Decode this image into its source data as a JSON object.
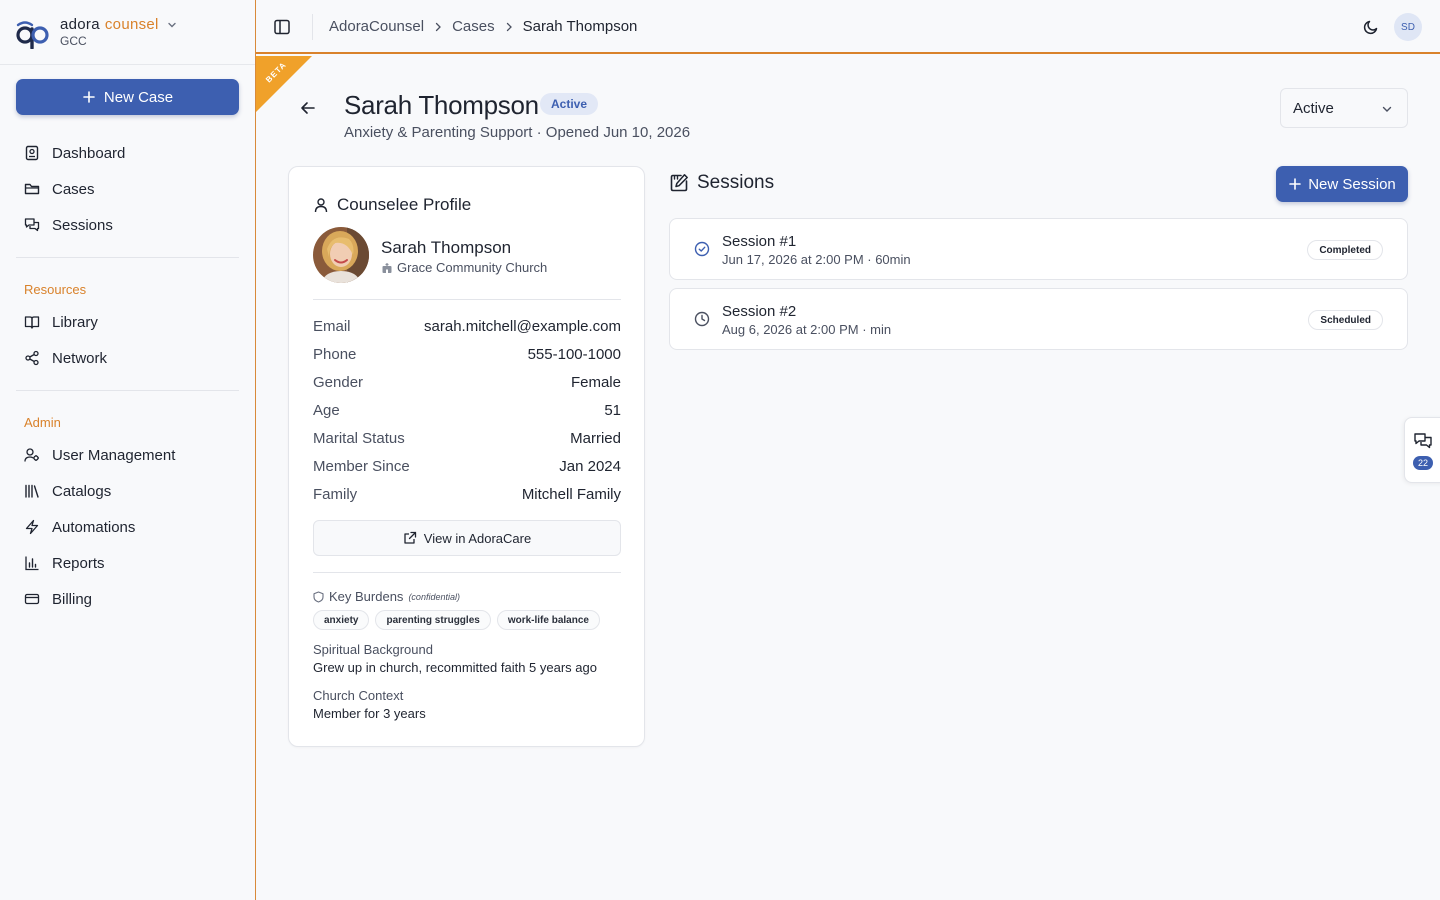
{
  "brand": {
    "name_a": "adora",
    "name_b": "counsel",
    "org": "GCC"
  },
  "sidebar": {
    "new_case_label": "New Case",
    "main_items": [
      {
        "label": "Dashboard",
        "icon": "dashboard-icon"
      },
      {
        "label": "Cases",
        "icon": "folder-icon"
      },
      {
        "label": "Sessions",
        "icon": "chat-icon"
      }
    ],
    "resources_heading": "Resources",
    "resources_items": [
      {
        "label": "Library",
        "icon": "book-icon"
      },
      {
        "label": "Network",
        "icon": "share-icon"
      }
    ],
    "admin_heading": "Admin",
    "admin_items": [
      {
        "label": "User Management",
        "icon": "users-icon"
      },
      {
        "label": "Catalogs",
        "icon": "library-icon"
      },
      {
        "label": "Automations",
        "icon": "bolt-icon"
      },
      {
        "label": "Reports",
        "icon": "bar-chart-icon"
      },
      {
        "label": "Billing",
        "icon": "credit-card-icon"
      }
    ]
  },
  "topbar": {
    "breadcrumbs": [
      "AdoraCounsel",
      "Cases",
      "Sarah Thompson"
    ],
    "user_initials": "SD"
  },
  "ribbon": {
    "label": "BETA"
  },
  "case": {
    "title": "Sarah Thompson",
    "badge": "Active",
    "subtitle": "Anxiety & Parenting Support · Opened Jun 10, 2026",
    "status_select": "Active"
  },
  "profile": {
    "card_title": "Counselee Profile",
    "name": "Sarah Thompson",
    "church": "Grace Community Church",
    "fields": [
      {
        "key": "Email",
        "value": "sarah.mitchell@example.com"
      },
      {
        "key": "Phone",
        "value": "555-100-1000"
      },
      {
        "key": "Gender",
        "value": "Female"
      },
      {
        "key": "Age",
        "value": "51"
      },
      {
        "key": "Marital Status",
        "value": "Married"
      },
      {
        "key": "Member Since",
        "value": "Jan 2024"
      },
      {
        "key": "Family",
        "value": "Mitchell Family"
      }
    ],
    "view_button": "View in AdoraCare",
    "burdens_label": "Key Burdens",
    "burdens_note": "(confidential)",
    "burdens": [
      "anxiety",
      "parenting struggles",
      "work-life balance"
    ],
    "spiritual_label": "Spiritual Background",
    "spiritual_value": "Grew up in church, recommitted faith 5 years ago",
    "church_context_label": "Church Context",
    "church_context_value": "Member for 3 years"
  },
  "sessions": {
    "title": "Sessions",
    "new_button": "New Session",
    "items": [
      {
        "title": "Session #1",
        "meta": "Jun 17, 2026 at 2:00 PM · 60min",
        "status": "Completed",
        "icon": "check-circle-icon"
      },
      {
        "title": "Session #2",
        "meta": "Aug 6, 2026 at 2:00 PM · min",
        "status": "Scheduled",
        "icon": "clock-icon"
      }
    ]
  },
  "chat_widget": {
    "count": "22"
  },
  "colors": {
    "primary": "#3d5fb0",
    "accent": "#d9822b",
    "ribbon": "#f0a12a"
  }
}
